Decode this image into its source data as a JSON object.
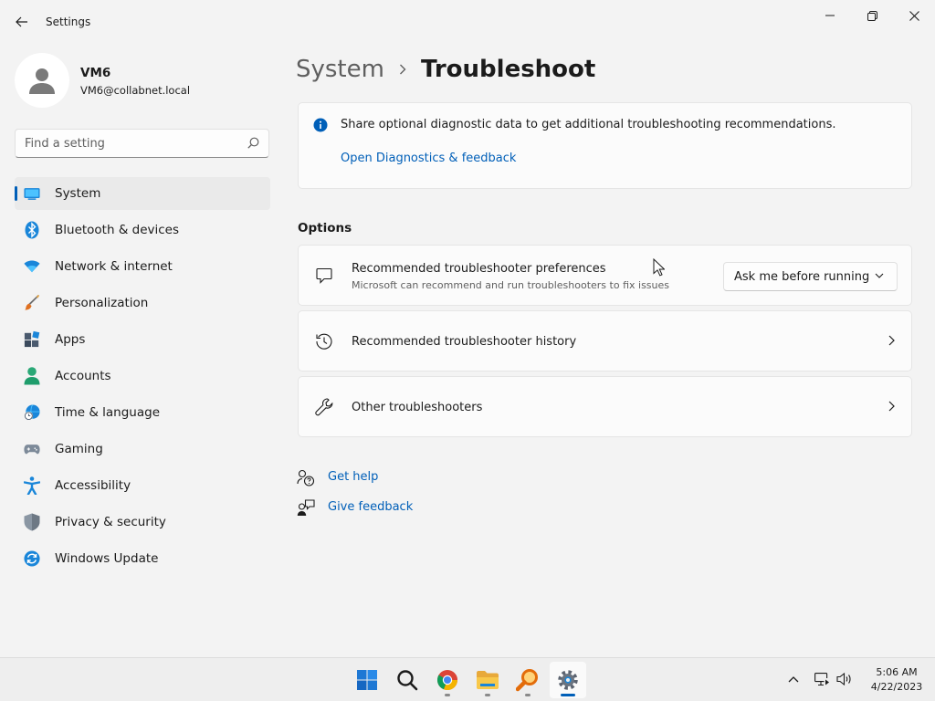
{
  "window": {
    "title": "Settings"
  },
  "profile": {
    "name": "VM6",
    "email": "VM6@collabnet.local"
  },
  "search": {
    "placeholder": "Find a setting"
  },
  "sidebar": {
    "items": [
      {
        "label": "System",
        "icon": "monitor-icon",
        "active": true
      },
      {
        "label": "Bluetooth & devices",
        "icon": "bluetooth-icon"
      },
      {
        "label": "Network & internet",
        "icon": "wifi-icon"
      },
      {
        "label": "Personalization",
        "icon": "brush-icon"
      },
      {
        "label": "Apps",
        "icon": "apps-icon"
      },
      {
        "label": "Accounts",
        "icon": "person-icon"
      },
      {
        "label": "Time & language",
        "icon": "globe-clock-icon"
      },
      {
        "label": "Gaming",
        "icon": "gamepad-icon"
      },
      {
        "label": "Accessibility",
        "icon": "accessibility-icon"
      },
      {
        "label": "Privacy & security",
        "icon": "shield-icon"
      },
      {
        "label": "Windows Update",
        "icon": "update-icon"
      }
    ]
  },
  "breadcrumb": {
    "parent": "System",
    "current": "Troubleshoot"
  },
  "info": {
    "text": "Share optional diagnostic data to get additional troubleshooting recommendations.",
    "link": "Open Diagnostics & feedback"
  },
  "options": {
    "title": "Options",
    "rows": [
      {
        "title": "Recommended troubleshooter preferences",
        "description": "Microsoft can recommend and run troubleshooters to fix issues",
        "control": "Ask me before running",
        "icon": "chat-bubble-icon"
      },
      {
        "title": "Recommended troubleshooter history",
        "icon": "history-icon"
      },
      {
        "title": "Other troubleshooters",
        "icon": "wrench-icon"
      }
    ]
  },
  "help_links": {
    "get_help": "Get help",
    "give_feedback": "Give feedback"
  },
  "taskbar": {
    "apps": [
      "start-icon",
      "search-icon",
      "chrome-icon",
      "file-explorer-icon",
      "magnifier-app-icon",
      "settings-icon"
    ],
    "time": "5:06 AM",
    "date": "4/22/2023"
  },
  "colors": {
    "accent": "#005fb8",
    "background": "#f3f3f3",
    "card": "#fbfbfb"
  }
}
